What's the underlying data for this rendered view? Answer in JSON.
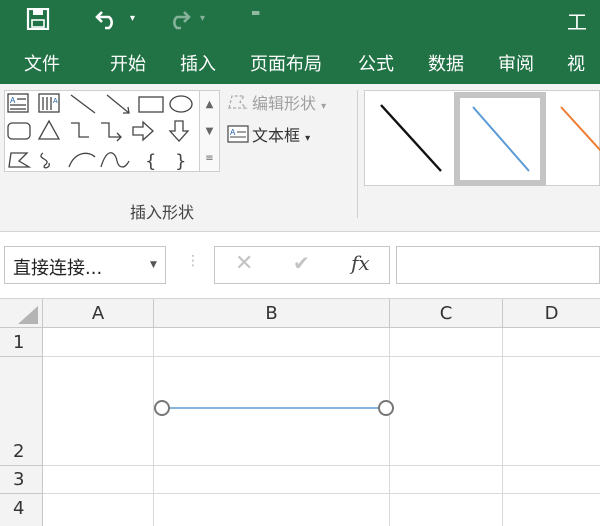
{
  "title_bar": {
    "title_fragment": "工",
    "icons": [
      "save-icon",
      "undo-icon",
      "redo-icon",
      "customize-qat-icon"
    ],
    "accent_color": "#217346"
  },
  "ribbon_tabs": [
    "文件",
    "开始",
    "插入",
    "页面布局",
    "公式",
    "数据",
    "审阅",
    "视"
  ],
  "ribbon": {
    "edit_shape_label": "编辑形状",
    "textbox_label": "文本框",
    "group_label": "插入形状",
    "shape_icons": [
      "textbox-icon",
      "vertical-textbox-icon",
      "line-icon",
      "arrow-line-icon",
      "rectangle-icon",
      "oval-icon",
      "rounded-rectangle-icon",
      "triangle-icon",
      "elbow-connector-icon",
      "elbow-arrow-connector-icon",
      "right-arrow-icon",
      "down-arrow-icon",
      "freeform-icon",
      "scribble-icon",
      "arc-icon",
      "curve-icon",
      "left-brace-icon",
      "right-brace-icon"
    ]
  },
  "formula_bar": {
    "name_box_value": "直接连接...",
    "cancel_symbol": "✕",
    "enter_symbol": "✔",
    "function_label": "fx",
    "formula_value": ""
  },
  "grid": {
    "columns": [
      "A",
      "B",
      "C",
      "D"
    ],
    "rows": [
      "1",
      "2",
      "3",
      "4"
    ]
  }
}
